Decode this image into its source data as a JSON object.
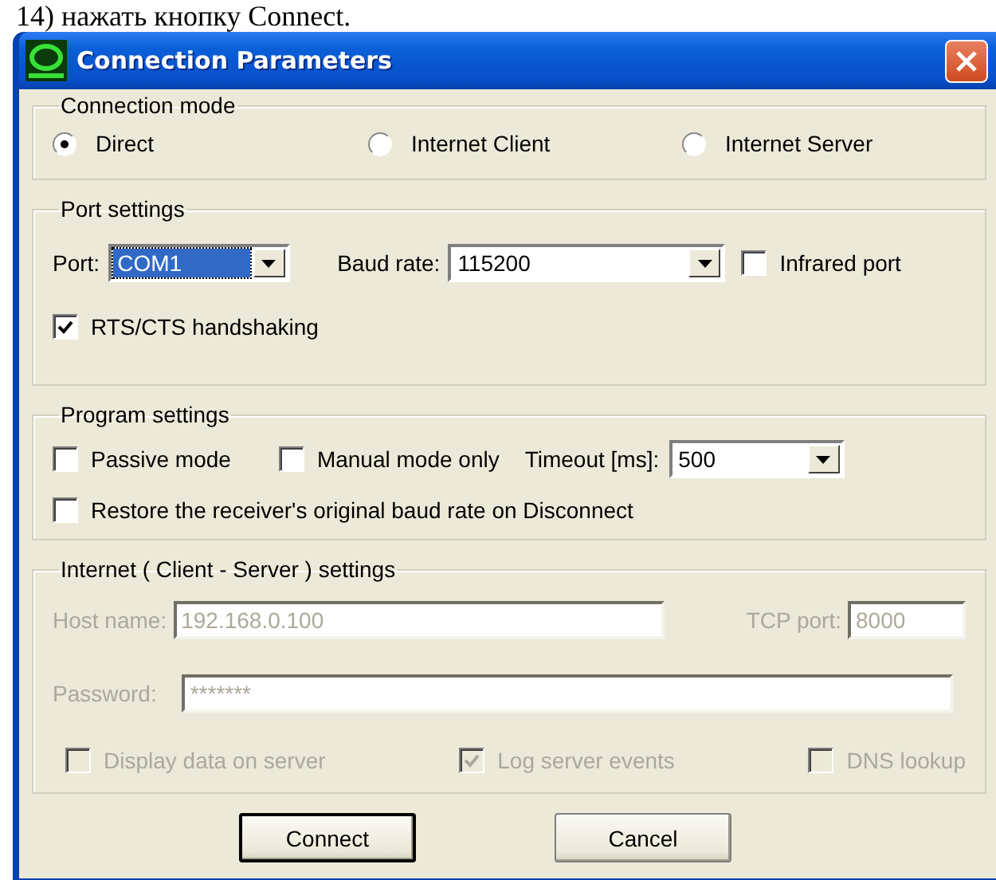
{
  "caption": "14) нажать кнопку Connect.",
  "window": {
    "title": "Connection Parameters"
  },
  "connection_mode": {
    "label": "Connection mode",
    "options": [
      {
        "label": "Direct",
        "selected": true
      },
      {
        "label": "Internet Client",
        "selected": false
      },
      {
        "label": "Internet Server",
        "selected": false
      }
    ]
  },
  "port_settings": {
    "label": "Port settings",
    "port": {
      "label": "Port:",
      "value": "COM1",
      "focused": true
    },
    "baud_rate": {
      "label": "Baud rate:",
      "value": "115200"
    },
    "infrared": {
      "label": "Infrared port",
      "checked": false
    },
    "rts_cts": {
      "label": "RTS/CTS handshaking",
      "checked": true
    }
  },
  "program_settings": {
    "label": "Program settings",
    "checkboxes": [
      {
        "label": "Passive mode",
        "checked": false
      },
      {
        "label": "Manual mode only",
        "checked": false
      }
    ],
    "timeout": {
      "label": "Timeout [ms]:",
      "value": "500"
    },
    "restore": {
      "label": "Restore the receiver's original baud rate on Disconnect",
      "checked": false
    }
  },
  "internet": {
    "label": "Internet ( Client - Server ) settings",
    "disabled": true,
    "host": {
      "label": "Host name:",
      "value": "192.168.0.100"
    },
    "tcp_port": {
      "label": "TCP port:",
      "value": "8000"
    },
    "password": {
      "label": "Password:",
      "value": "*******"
    },
    "checkboxes": [
      {
        "label": "Display data on server",
        "checked": false
      },
      {
        "label": "Log server events",
        "checked": true
      },
      {
        "label": "DNS lookup",
        "checked": false
      }
    ]
  },
  "buttons": [
    {
      "label": "Connect",
      "default": true
    },
    {
      "label": "Cancel",
      "default": false
    }
  ]
}
